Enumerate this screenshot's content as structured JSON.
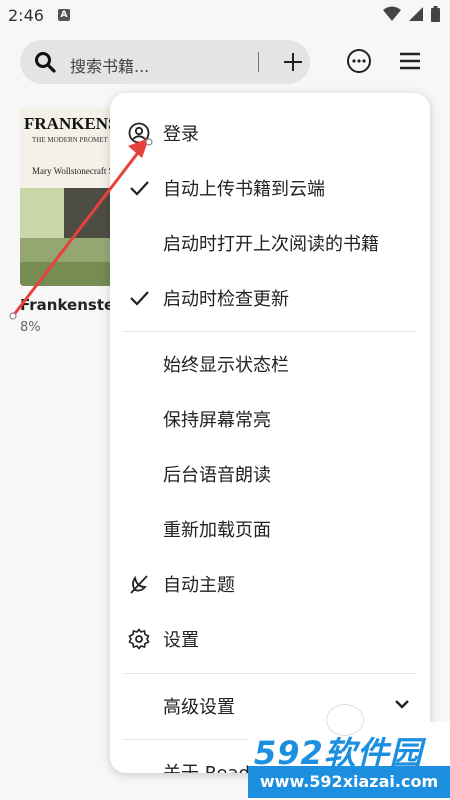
{
  "status_bar": {
    "time": "2:46",
    "app_icon_letter": "A"
  },
  "search": {
    "placeholder": "搜索书籍..."
  },
  "icons": {
    "search": "search-icon",
    "add": "plus-icon",
    "more": "more-horizontal-icon",
    "menu": "hamburger-menu-icon",
    "login": "account-circle-icon",
    "check": "checkmark-icon",
    "auto_theme": "theme-auto-icon",
    "settings": "gear-icon",
    "expand": "chevron-down-icon"
  },
  "book": {
    "cover_title": "FRANKENST",
    "cover_subtitle": "THE MODERN PROMET",
    "cover_author": "Mary Wollstonecraft S",
    "title": "Frankenstein",
    "progress": "8%"
  },
  "menu": {
    "login": "登录",
    "auto_upload": "自动上传书籍到云端",
    "open_last_book": "启动时打开上次阅读的书籍",
    "check_updates": "启动时检查更新",
    "always_show_status_bar": "始终显示状态栏",
    "keep_screen_on": "保持屏幕常亮",
    "background_tts": "后台语音朗读",
    "reload_page": "重新加载页面",
    "auto_theme": "自动主题",
    "settings": "设置",
    "advanced_settings": "高级设置",
    "about": "关于 Read"
  },
  "watermark": {
    "brand": "592软件园",
    "url": "www.592xiazai.com"
  },
  "colors": {
    "accent_arrow": "#e8413c",
    "watermark_blue": "#1d8fe0"
  }
}
